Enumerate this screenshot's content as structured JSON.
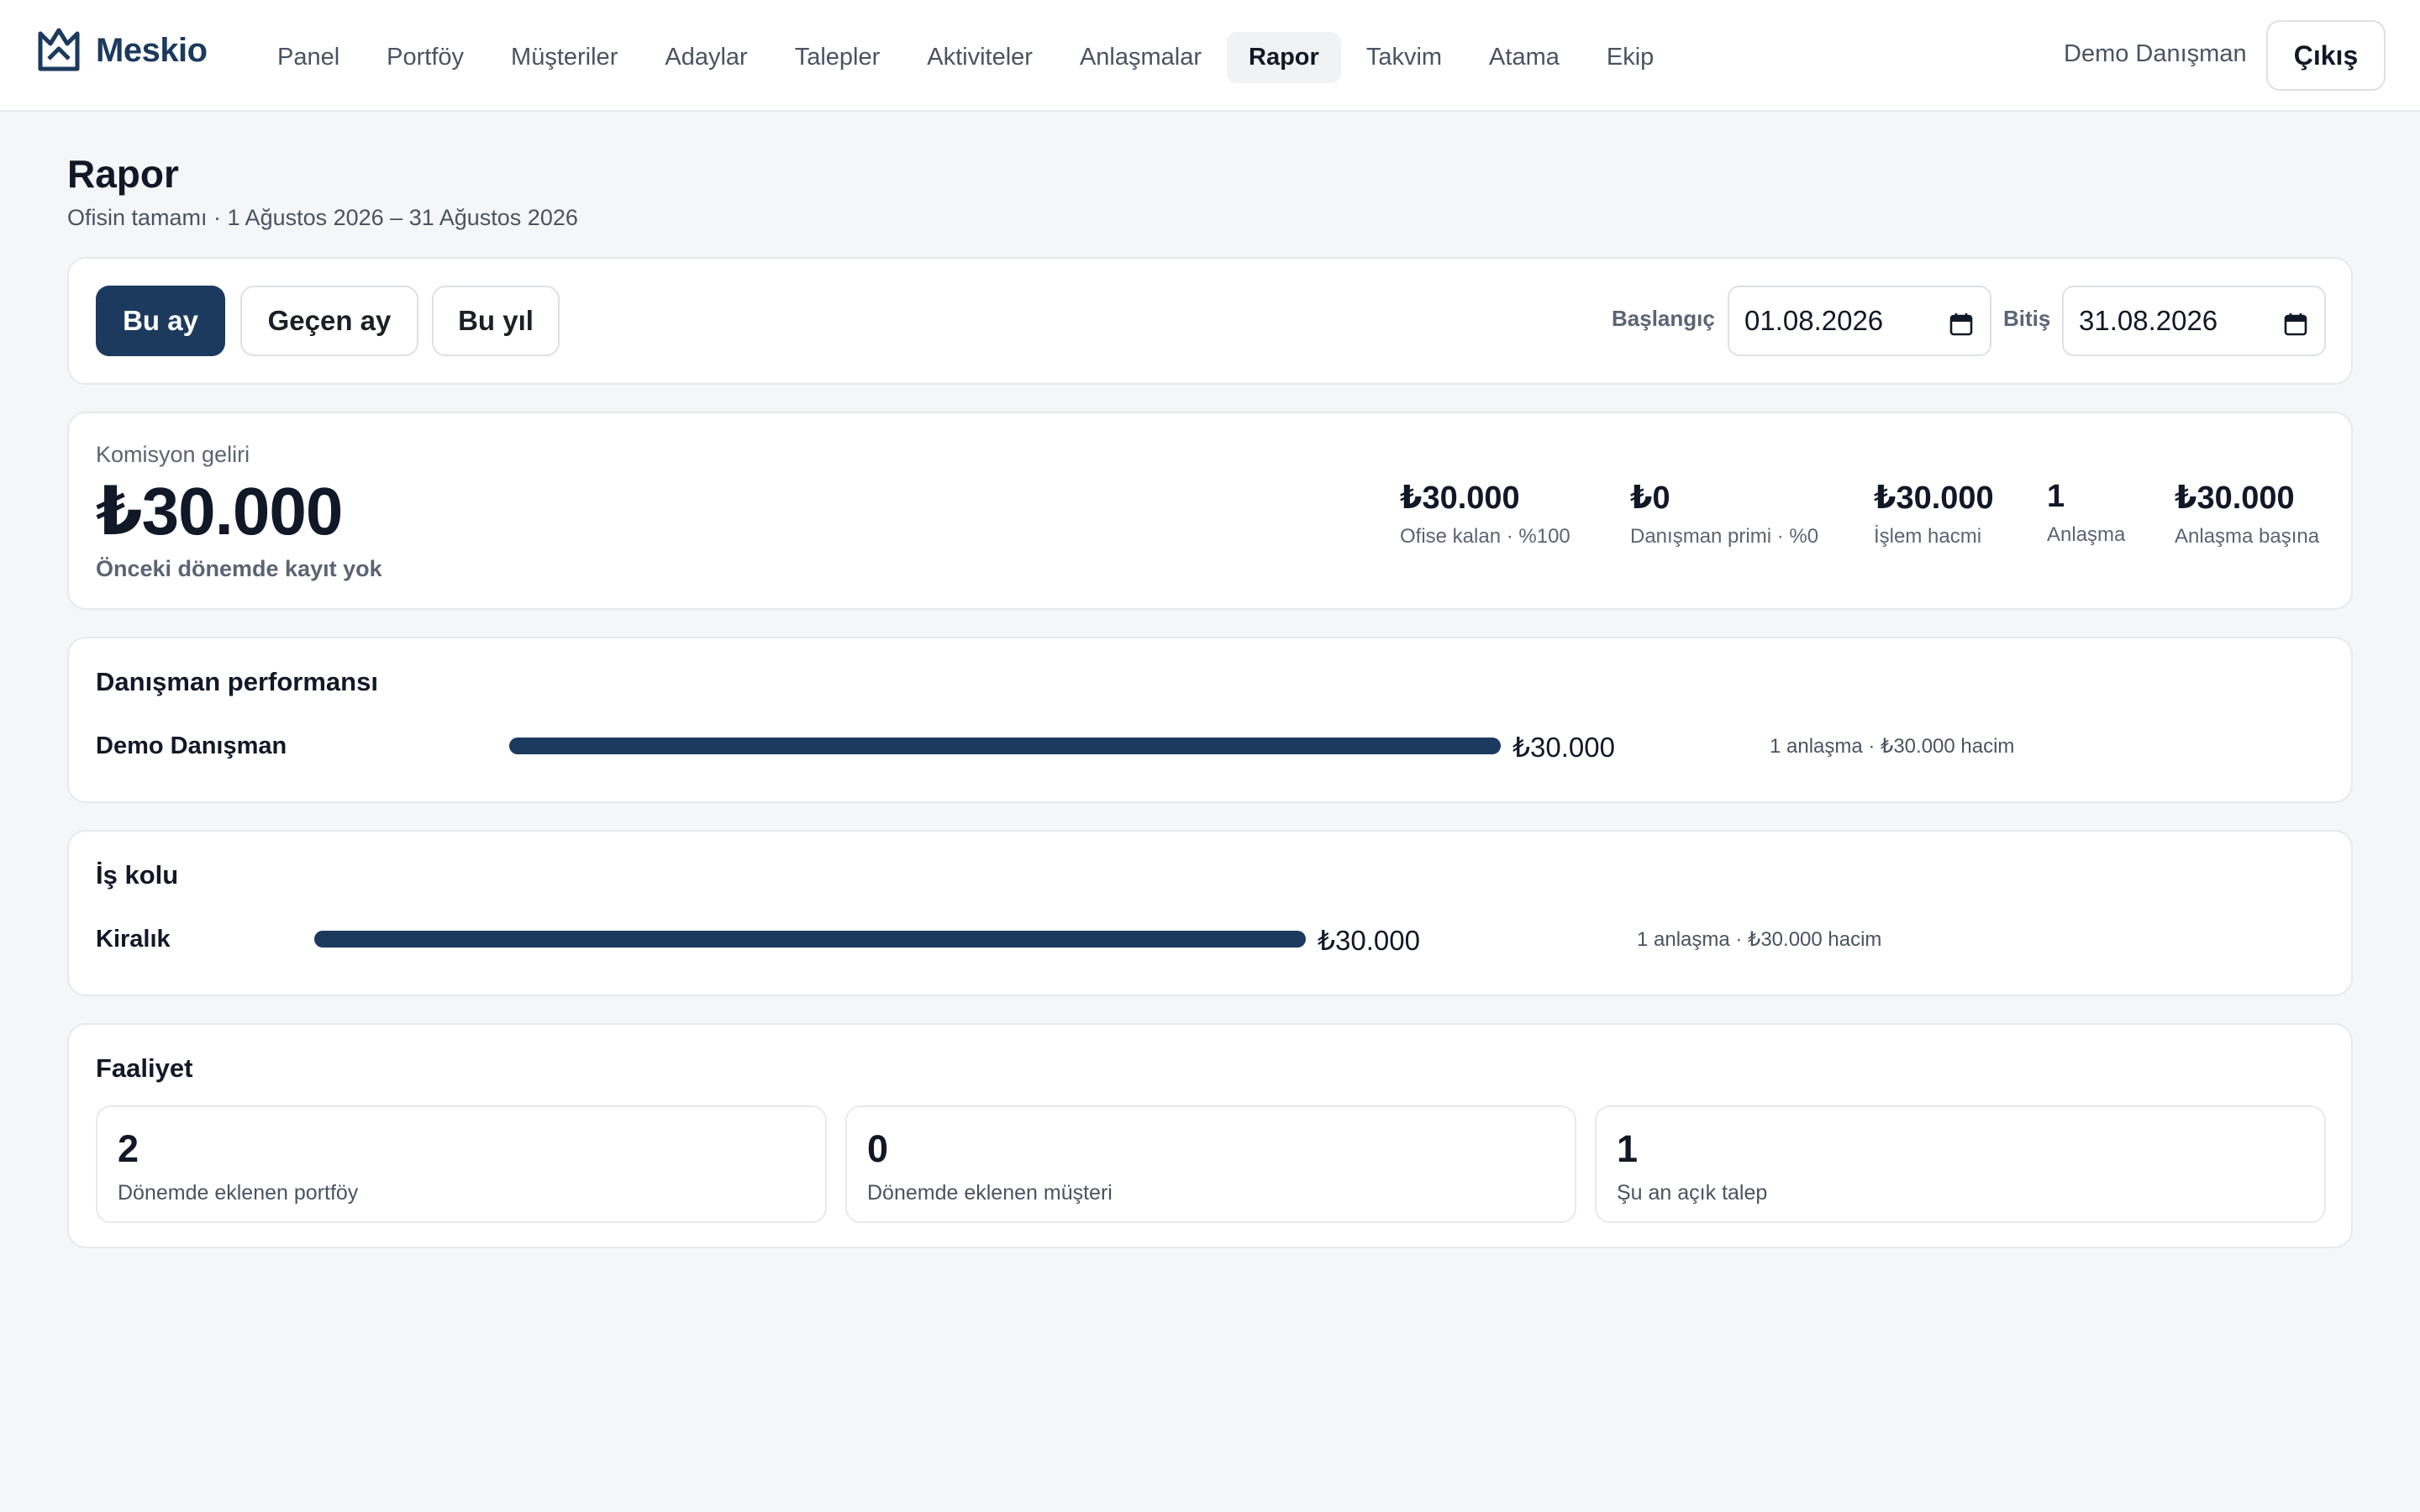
{
  "app": {
    "brand": "Meskio"
  },
  "nav": [
    {
      "label": "Panel",
      "active": false
    },
    {
      "label": "Portföy",
      "active": false
    },
    {
      "label": "Müşteriler",
      "active": false
    },
    {
      "label": "Adaylar",
      "active": false
    },
    {
      "label": "Talepler",
      "active": false
    },
    {
      "label": "Aktiviteler",
      "active": false
    },
    {
      "label": "Anlaşmalar",
      "active": false
    },
    {
      "label": "Rapor",
      "active": true
    },
    {
      "label": "Takvim",
      "active": false
    },
    {
      "label": "Atama",
      "active": false
    },
    {
      "label": "Ekip",
      "active": false
    }
  ],
  "header": {
    "user_name": "Demo Danışman",
    "logout_label": "Çıkış"
  },
  "page": {
    "title": "Rapor",
    "subtitle": "Ofisin tamamı · 1 Ağustos 2026 – 31 Ağustos 2026"
  },
  "filter": {
    "this_month": "Bu ay",
    "last_month": "Geçen ay",
    "this_year": "Bu yıl",
    "start_label": "Başlangıç",
    "start_value": "01.08.2026",
    "end_label": "Bitiş",
    "end_value": "31.08.2026"
  },
  "commission": {
    "label": "Komisyon geliri",
    "value": "₺30.000",
    "note": "Önceki dönemde kayıt yok",
    "stats": [
      {
        "value": "₺30.000",
        "label": "Ofise kalan · %100"
      },
      {
        "value": "₺0",
        "label": "Danışman primi · %0"
      },
      {
        "value": "₺30.000",
        "label": "İşlem hacmi"
      },
      {
        "value": "1",
        "label": "Anlaşma"
      },
      {
        "value": "₺30.000",
        "label": "Anlaşma başına"
      }
    ]
  },
  "performance": {
    "title": "Danışman performansı",
    "rows": [
      {
        "label": "Demo Danışman",
        "value": "₺30.000",
        "meta": "1 anlaşma · ₺30.000 hacim",
        "fill": 1.0
      }
    ]
  },
  "business_line": {
    "title": "İş kolu",
    "rows": [
      {
        "label": "Kiralık",
        "value": "₺30.000",
        "meta": "1 anlaşma · ₺30.000 hacim",
        "fill": 1.0
      }
    ]
  },
  "activity": {
    "title": "Faaliyet",
    "items": [
      {
        "value": "2",
        "label": "Dönemde eklenen portföy"
      },
      {
        "value": "0",
        "label": "Dönemde eklenen müşteri"
      },
      {
        "value": "1",
        "label": "Şu an açık talep"
      }
    ]
  },
  "colors": {
    "brand": "#1c3a5e",
    "page_bg": "#f5f6f8"
  }
}
